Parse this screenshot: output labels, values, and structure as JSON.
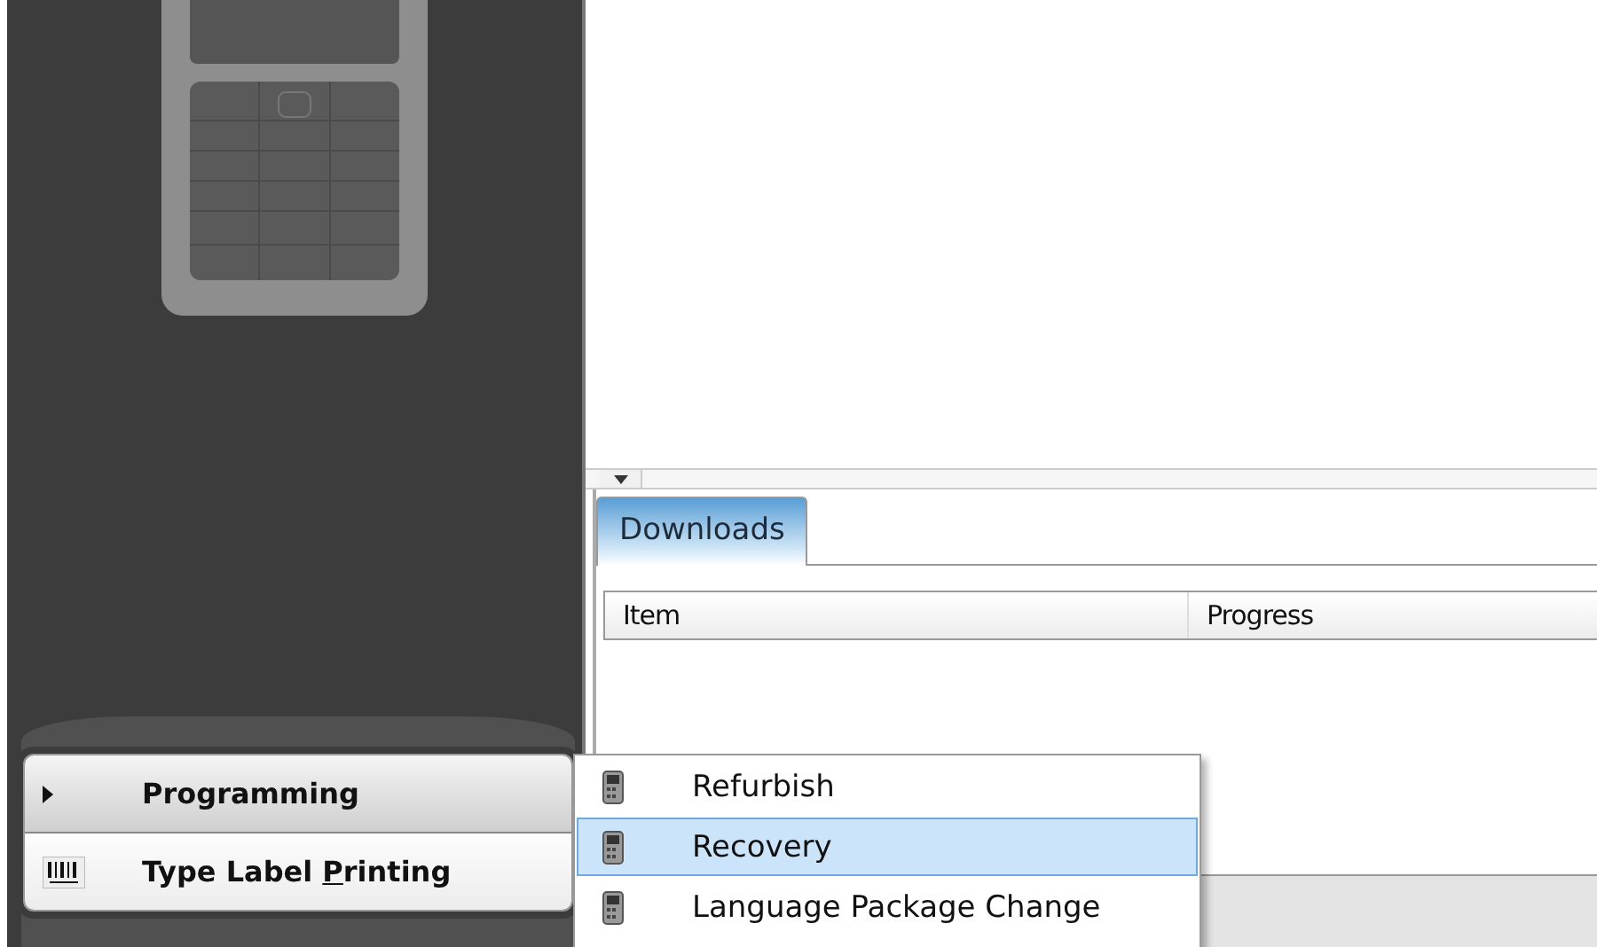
{
  "downloads_panel": {
    "tabs": [
      {
        "label": "Downloads",
        "selected": true
      }
    ],
    "table": {
      "columns": [
        "Item",
        "Progress"
      ]
    }
  },
  "main_menu": [
    {
      "kind": "submenu",
      "label": "Programming",
      "selected": true
    },
    {
      "kind": "barcode",
      "label_before": "Type Label ",
      "access_key": "P",
      "label_after": "rinting",
      "selected": false
    }
  ],
  "submenu": [
    {
      "label": "Refurbish",
      "selected": false
    },
    {
      "label": "Recovery",
      "selected": true
    },
    {
      "label": "Language Package Change",
      "selected": false
    }
  ]
}
